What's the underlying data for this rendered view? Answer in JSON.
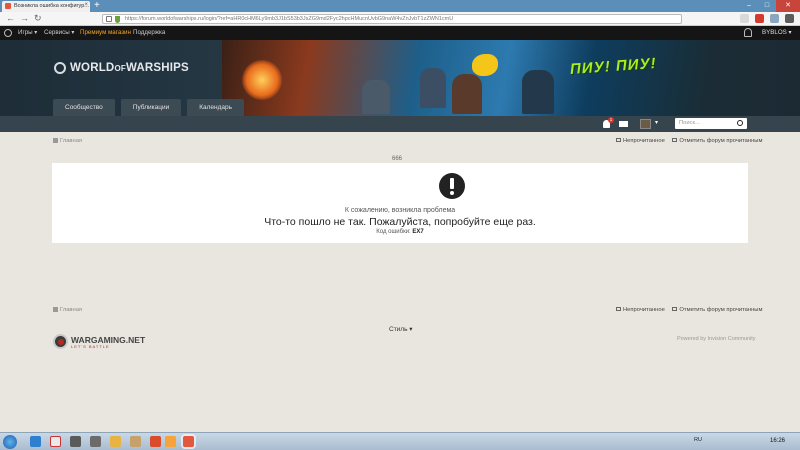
{
  "browser": {
    "tab_title": "Возникла ошибка конфигур...",
    "tab_close": "×",
    "new_tab": "+",
    "url": "https://forum.worldofwarships.ru/login/?ref=aHR0cHM6Ly9mb3J1bS53b3JsZG9md2Fyc2hpcHMucnUvbG9naW4vZnJvbT1zZWN1cmU",
    "back": "←",
    "forward": "→",
    "reload": "↻",
    "minimize": "–",
    "maximize": "□",
    "close": "✕"
  },
  "topbar": {
    "games": "Игры ▾",
    "services": "Сервисы ▾",
    "premium": "Премиум магазин",
    "support": "Поддержка",
    "user": "BYBLOS ▾"
  },
  "header": {
    "logo_world": "WORLD",
    "logo_of": "OF",
    "logo_warships": "WARSHIPS",
    "banner_slogan": "ПИУ! ПИУ!",
    "tabs": [
      {
        "label": "Сообщество"
      },
      {
        "label": "Публикации"
      },
      {
        "label": "Календарь"
      }
    ]
  },
  "userstrip": {
    "notif_count": "1",
    "avatar_caret": "▾",
    "search_placeholder": "Поиск..."
  },
  "breadcrumb": {
    "home": "Главная",
    "unread": "Непрочитанное",
    "mark_read": "Отметить форум прочитанным"
  },
  "error": {
    "code_top": "666",
    "sorry": "К сожалению, возникла проблема",
    "message": "Что-то пошло не так. Пожалуйста, попробуйте еще раз.",
    "code_label": "Код ошибки:",
    "code_value": "EX7"
  },
  "footer": {
    "home": "Главная",
    "unread": "Непрочитанное",
    "mark_read": "Отметить форум прочитанным",
    "style": "Стиль ▾",
    "wg_name": "WARGAMING.NET",
    "wg_tag": "LET'S BATTLE",
    "powered": "Powered by Invision Community"
  },
  "taskbar": {
    "lang": "RU",
    "time": "16:26"
  }
}
